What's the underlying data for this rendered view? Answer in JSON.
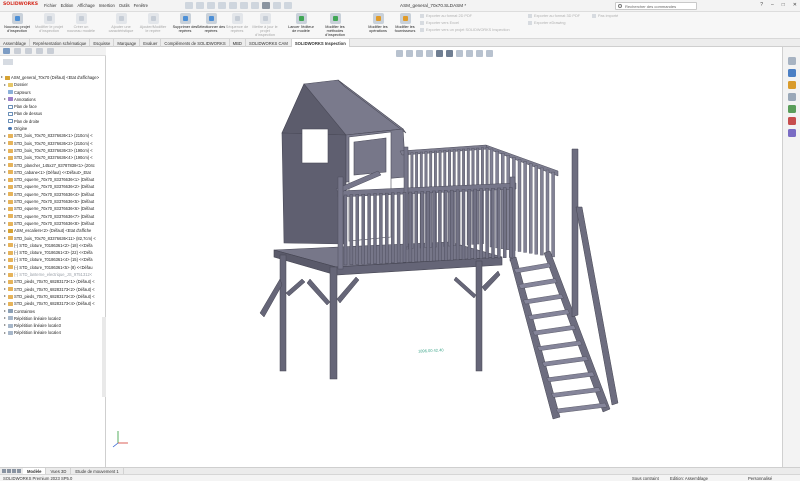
{
  "app": {
    "logo_text": "SOLIDWORKS",
    "document_title": "ASM_general_70x70.SLDASM *",
    "search_placeholder": "Rechercher des commandes"
  },
  "menu": [
    "Fichier",
    "Edition",
    "Affichage",
    "Insertion",
    "Outils",
    "Fenêtre"
  ],
  "ribbon": {
    "buttons": [
      {
        "label": "Nouveau projet d'inspection",
        "state": "enabled"
      },
      {
        "label": "Modifier le projet d'inspection",
        "state": "disabled"
      },
      {
        "label": "Créer un nouveau modèle",
        "state": "disabled"
      },
      {
        "label": "Ajouter une caractéristique",
        "state": "disabled"
      },
      {
        "label": "Ajouter/Modifier le repère",
        "state": "disabled"
      },
      {
        "label": "Supprimer des repères",
        "state": "enabled"
      },
      {
        "label": "Sélectionner des repères",
        "state": "enabled"
      },
      {
        "label": "Séquence de repères",
        "state": "disabled"
      },
      {
        "label": "Mettre à jour le projet d'inspection",
        "state": "disabled"
      },
      {
        "label": "Lancer l'éditeur de modèle",
        "state": "enabled"
      },
      {
        "label": "Modifier les méthodes d'inspection",
        "state": "enabled"
      },
      {
        "label": "Modifier les opérations",
        "state": "enabled"
      },
      {
        "label": "Modifier les fournisseurs",
        "state": "enabled"
      }
    ],
    "export_items": [
      "Exporter au format 2D PDF",
      "Exporter vers Excel",
      "Exporter vers un projet SOLIDWORKS Inspection",
      "Exporter au format 3D PDF",
      "Exporter eDrawing",
      "Pas importé"
    ]
  },
  "command_tabs": [
    {
      "label": "Assemblage",
      "active": false
    },
    {
      "label": "Représentation schématique",
      "active": false
    },
    {
      "label": "Esquisse",
      "active": false
    },
    {
      "label": "Marquage",
      "active": false
    },
    {
      "label": "Evaluer",
      "active": false
    },
    {
      "label": "Compléments de SOLIDWORKS",
      "active": false
    },
    {
      "label": "MBD",
      "active": false
    },
    {
      "label": "SOLIDWORKS CAM",
      "active": false
    },
    {
      "label": "SOLIDWORKS Inspection",
      "active": true
    }
  ],
  "feature_tree": [
    {
      "label": "ASM_general_70x70 (Défaut) <Etat d'affichage>",
      "icon": "assembly",
      "level": 0,
      "expander": true,
      "grey": false
    },
    {
      "label": "Dossier",
      "icon": "folder",
      "level": 1,
      "expander": true,
      "grey": false
    },
    {
      "label": "Capteurs",
      "icon": "sensor",
      "level": 1,
      "expander": false,
      "grey": false
    },
    {
      "label": "Annotations",
      "icon": "annotation",
      "level": 1,
      "expander": true,
      "grey": false
    },
    {
      "label": "Plan de face",
      "icon": "plane",
      "level": 1,
      "expander": false,
      "grey": false
    },
    {
      "label": "Plan de dessus",
      "icon": "plane",
      "level": 1,
      "expander": false,
      "grey": false
    },
    {
      "label": "Plan de droite",
      "icon": "plane",
      "level": 1,
      "expander": false,
      "grey": false
    },
    {
      "label": "Origine",
      "icon": "origin",
      "level": 1,
      "expander": false,
      "grey": false
    },
    {
      "label": "STD_bois_70x70_83376636<1> (210cm) <",
      "icon": "part",
      "level": 1,
      "expander": true,
      "grey": false
    },
    {
      "label": "STD_bois_70x70_83376636<2> (210cm) <",
      "icon": "part",
      "level": 1,
      "expander": true,
      "grey": false
    },
    {
      "label": "STD_bois_70x70_83376636<3> (190cm) <",
      "icon": "part",
      "level": 1,
      "expander": true,
      "grey": false
    },
    {
      "label": "STD_bois_70x70_83376636<4> (190cm) <",
      "icon": "part",
      "level": 1,
      "expander": true,
      "grey": false
    },
    {
      "label": "STD_plancher_145x27_83787838<1> (204c",
      "icon": "part",
      "level": 1,
      "expander": true,
      "grey": false
    },
    {
      "label": "STD_cabane<1> (Défaut) <<Défaut>_Etat",
      "icon": "part",
      "level": 1,
      "expander": true,
      "grey": false
    },
    {
      "label": "STD_equerre_70x70_83376636<1> (Défaut",
      "icon": "part",
      "level": 1,
      "expander": true,
      "grey": false
    },
    {
      "label": "STD_equerre_70x70_83376636<2> (Défaut",
      "icon": "part",
      "level": 1,
      "expander": true,
      "grey": false
    },
    {
      "label": "STD_equerre_70x70_83376636<4> (Défaut",
      "icon": "part",
      "level": 1,
      "expander": true,
      "grey": false
    },
    {
      "label": "STD_equerre_70x70_83376636<5> (Défaut",
      "icon": "part",
      "level": 1,
      "expander": true,
      "grey": false
    },
    {
      "label": "STD_equerre_70x70_83376636<6> (Défaut",
      "icon": "part",
      "level": 1,
      "expander": true,
      "grey": false
    },
    {
      "label": "STD_equerre_70x70_83376636<7> (Défaut",
      "icon": "part",
      "level": 1,
      "expander": true,
      "grey": false
    },
    {
      "label": "STD_equerre_70x70_83376636<8> (Défaut",
      "icon": "part",
      "level": 1,
      "expander": true,
      "grey": false
    },
    {
      "label": "ASM_escaliers<2> (Défaut) <Etat d'affiche",
      "icon": "assembly",
      "level": 1,
      "expander": true,
      "grey": false
    },
    {
      "label": "STD_bois_70x70_83376636<11> (82,7cm) <",
      "icon": "part",
      "level": 1,
      "expander": true,
      "grey": false
    },
    {
      "label": "(-) STD_cloture_70186361<2> (18) <<Défa",
      "icon": "part",
      "level": 1,
      "expander": true,
      "grey": false
    },
    {
      "label": "(-) STD_cloture_70186361<3> (22) <<Défa",
      "icon": "part",
      "level": 1,
      "expander": true,
      "grey": false
    },
    {
      "label": "(-) STD_cloture_70186361<4> (15) <<Défa",
      "icon": "part",
      "level": 1,
      "expander": true,
      "grey": false
    },
    {
      "label": "(-) STD_cloture_70186361<5> (8) <<Défau",
      "icon": "part",
      "level": 1,
      "expander": true,
      "grey": false
    },
    {
      "label": "(-) STD_lanterne_electrique_JS_9751312<",
      "icon": "part",
      "level": 1,
      "expander": true,
      "grey": true
    },
    {
      "label": "STD_pieds_70x70_68283173<1> (Défaut) <",
      "icon": "part",
      "level": 1,
      "expander": true,
      "grey": false
    },
    {
      "label": "STD_pieds_70x70_68283173<2> (Défaut) <",
      "icon": "part",
      "level": 1,
      "expander": true,
      "grey": false
    },
    {
      "label": "STD_pieds_70x70_68283173<3> (Défaut) <",
      "icon": "part",
      "level": 1,
      "expander": true,
      "grey": false
    },
    {
      "label": "STD_pieds_70x70_68283173<4> (Défaut) <",
      "icon": "part",
      "level": 1,
      "expander": true,
      "grey": false
    },
    {
      "label": "Contraintes",
      "icon": "mate",
      "level": 1,
      "expander": true,
      "grey": false
    },
    {
      "label": "Répétition linéaire locale2",
      "icon": "pattern",
      "level": 1,
      "expander": true,
      "grey": false
    },
    {
      "label": "Répétition linéaire locale3",
      "icon": "pattern",
      "level": 1,
      "expander": true,
      "grey": false
    },
    {
      "label": "Répétition linéaire locale4",
      "icon": "pattern",
      "level": 1,
      "expander": true,
      "grey": false
    }
  ],
  "viewport": {
    "dimension_label": "1896.00 42.40",
    "model_color": "#6e6e80"
  },
  "bottom_tabs": [
    {
      "label": "Modèle",
      "active": true
    },
    {
      "label": "Vues 3D",
      "active": false
    },
    {
      "label": "Etude de mouvement 1",
      "active": false
    }
  ],
  "status": {
    "version": "SOLIDWORKS Premium 2023 SP5.0",
    "state": "Sous contraint",
    "mode": "Edition: Assemblage",
    "units": "Personnalisé"
  }
}
